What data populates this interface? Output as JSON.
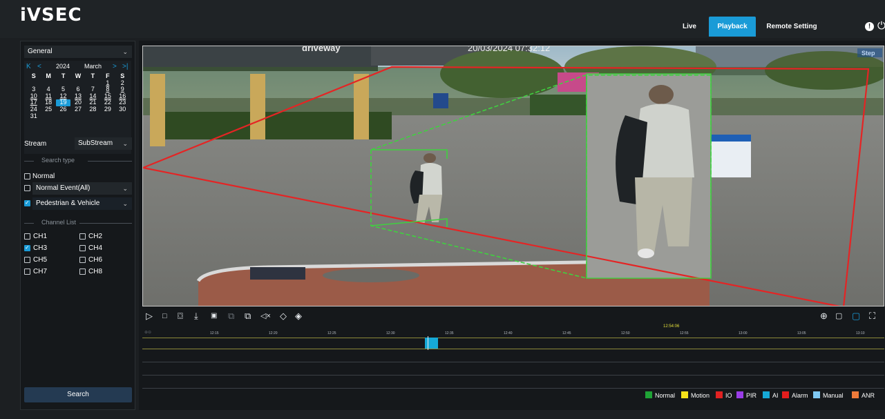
{
  "app": {
    "logo": "iVSEC"
  },
  "nav": {
    "live": "Live",
    "playback": "Playback",
    "remote": "Remote Setting",
    "info_icon": "!",
    "power_icon": "⏻"
  },
  "sidebar": {
    "mode_select": "General",
    "calendar": {
      "year": "2024",
      "month": "March",
      "nav_first": "K",
      "nav_prev": "<",
      "nav_next": ">",
      "nav_last": ">|",
      "dow": [
        "S",
        "M",
        "T",
        "W",
        "T",
        "F",
        "S"
      ],
      "days": [
        "",
        "",
        "",
        "",
        "",
        "1",
        "2",
        "3",
        "4",
        "5",
        "6",
        "7",
        "8",
        "9",
        "10",
        "11",
        "12",
        "13",
        "14",
        "15",
        "16",
        "17",
        "18",
        "19",
        "20",
        "21",
        "22",
        "23",
        "24",
        "25",
        "26",
        "27",
        "28",
        "29",
        "30",
        "31"
      ],
      "today": "19",
      "recorded_days": [
        "1",
        "8",
        "9",
        "10",
        "11",
        "12",
        "13",
        "14",
        "15",
        "16",
        "17"
      ]
    },
    "stream_label": "Stream",
    "stream_value": "SubStream",
    "search_type_label": "Search type",
    "normal_label": "Normal",
    "normal_event_value": "Normal Event(All)",
    "ped_value": "Pedestrian & Vehicle",
    "channel_list_label": "Channel List",
    "channels": [
      {
        "name": "CH1",
        "checked": false
      },
      {
        "name": "CH2",
        "checked": false
      },
      {
        "name": "CH3",
        "checked": true
      },
      {
        "name": "CH4",
        "checked": false
      },
      {
        "name": "CH5",
        "checked": false
      },
      {
        "name": "CH6",
        "checked": false
      },
      {
        "name": "CH7",
        "checked": false
      },
      {
        "name": "CH8",
        "checked": false
      }
    ],
    "search_button": "Search"
  },
  "video": {
    "osd_timestamp": "20/03/2024 07:32:12",
    "osd_title": "driveway",
    "step_label": "Step"
  },
  "toolbar_icons": [
    "play-icon",
    "stop-icon",
    "snapshot-icon",
    "download-icon",
    "speed-icon",
    "clip-icon",
    "clip-copy-icon",
    "mute-icon",
    "tag-icon",
    "tag-search-icon",
    "zoom-in-icon",
    "window-icon",
    "fullscreen-window-icon",
    "fullscreen-icon"
  ],
  "timeline": {
    "current_time": "12:54:06",
    "ticks": [
      "12:15",
      "12:20",
      "12:25",
      "12:30",
      "12:35",
      "12:40",
      "12:45",
      "12:50",
      "12:55",
      "13:00",
      "13:05",
      "13:10"
    ],
    "zoom_glyphs": "⊕⊖"
  },
  "legend": [
    {
      "label": "Normal",
      "color": "#1fa336"
    },
    {
      "label": "Motion",
      "color": "#f5e21a"
    },
    {
      "label": "IO",
      "color": "#e02222"
    },
    {
      "label": "PIR",
      "color": "#9a3de8"
    },
    {
      "label": "AI",
      "color": "#16a9d6"
    },
    {
      "label": "Alarm",
      "color": "#e31d1d"
    },
    {
      "label": "Manual",
      "color": "#7fc8f3"
    },
    {
      "label": "ANR",
      "color": "#ee7a3a"
    }
  ],
  "colors": {
    "accent": "#1a9bd7",
    "roi_red": "#e52424",
    "roi_green": "#3fd13f"
  }
}
